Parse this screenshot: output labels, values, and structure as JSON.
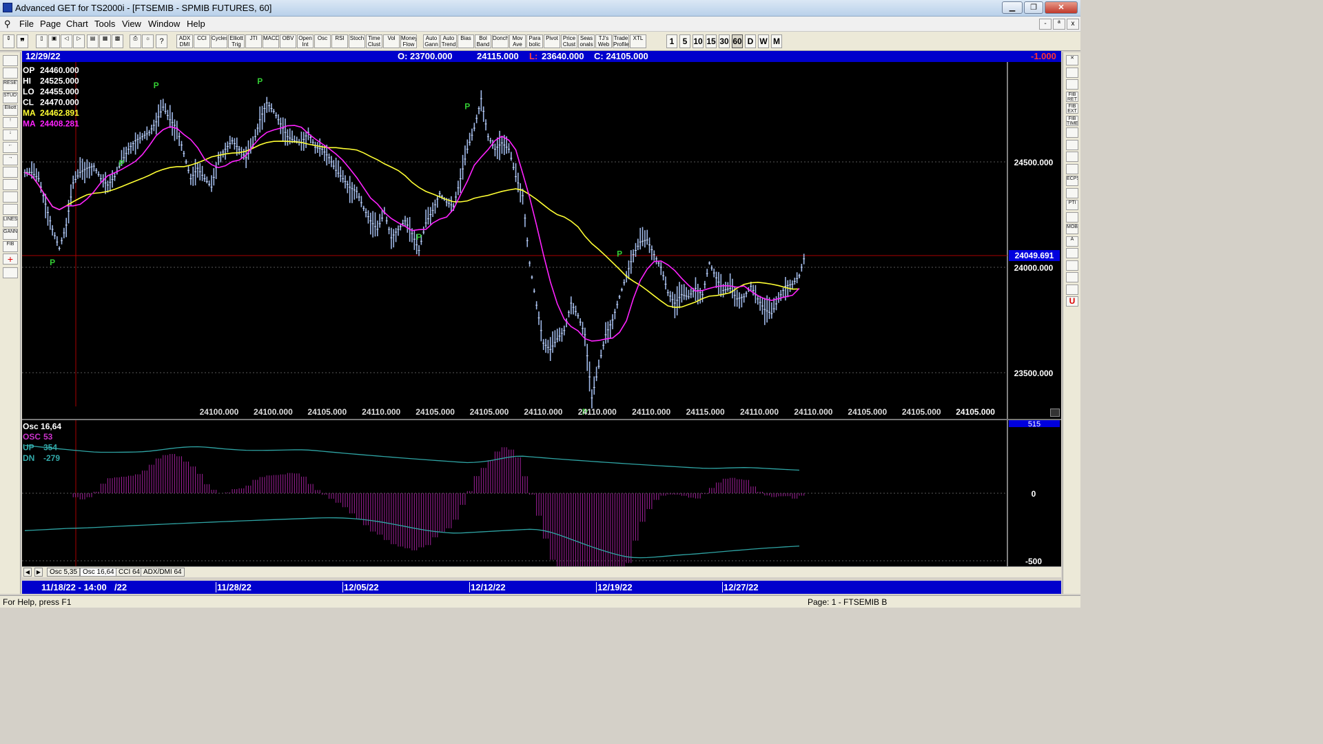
{
  "window": {
    "title": "Advanced GET for TS2000i - [FTSEMIB - SPMIB FUTURES, 60]",
    "minimize": "▁",
    "maximize": "❐",
    "close": "✕",
    "mdi_min": "-",
    "mdi_restore": "ª",
    "mdi_close": "x"
  },
  "menu": [
    "File",
    "Page",
    "Chart",
    "Tools",
    "View",
    "Window",
    "Help"
  ],
  "toolbar": {
    "study_buttons": [
      "ADX DMI",
      "CCI",
      "Cycles",
      "Elliott Trig",
      "JTI",
      "MACD",
      "OBV",
      "Open Int",
      "Osc",
      "RSI",
      "Stoch",
      "Time Clust",
      "Vol",
      "Money Flow",
      "Auto Gann",
      "Auto Trend",
      "Bias",
      "Bol Band",
      "Donch",
      "Mov Ave",
      "Para bolic",
      "Pivot",
      "Price Clust",
      "Seas onals",
      "TJ's Web",
      "Trade Profile",
      "XTL"
    ],
    "intervals": [
      "1",
      "5",
      "10",
      "15",
      "30",
      "60",
      "D",
      "W",
      "M"
    ],
    "selected_interval": "60"
  },
  "left_tools": [
    "",
    "",
    "RESET",
    "STUDY",
    "Elliott",
    "↑",
    "↓",
    "←",
    "→",
    "",
    "",
    "",
    "",
    "LINES",
    "GANN",
    "FIB",
    "+",
    ""
  ],
  "right_tools": [
    "✕",
    "",
    "",
    "FIB RET",
    "FIB EXT",
    "FIB TIME",
    "",
    "",
    "",
    "",
    "ECPS",
    "",
    "PTI",
    "",
    "MOB",
    "A",
    "",
    "",
    "",
    "",
    "U"
  ],
  "infobar": {
    "date": "12/29/22",
    "open": "O: 23700.000",
    "high": "24115.000",
    "low_label": "L:",
    "low": "23640.000",
    "close": "C: 24105.000",
    "change": "-1.000"
  },
  "legend": [
    {
      "label": "OP",
      "value": "24460.000",
      "color": "#ffffff"
    },
    {
      "label": "HI",
      "value": "24525.000",
      "color": "#ffffff"
    },
    {
      "label": "LO",
      "value": "24455.000",
      "color": "#ffffff"
    },
    {
      "label": "CL",
      "value": "24470.000",
      "color": "#ffffff"
    },
    {
      "label": "MA",
      "value": "24462.891",
      "color": "#ffff33"
    },
    {
      "label": "MA",
      "value": "24408.281",
      "color": "#ff22ff"
    }
  ],
  "price_axis": {
    "labels": [
      "24500.000",
      "24000.000",
      "23500.000"
    ],
    "crosshair_value": "24049.691"
  },
  "pivot_label": "P",
  "bottom_values": [
    "24100.000",
    "24100.000",
    "24105.000",
    "24110.000",
    "24105.000",
    "24105.000",
    "24110.000",
    "24110.000",
    "24110.000",
    "24115.000",
    "24110.000",
    "24110.000",
    "24105.000",
    "24105.000",
    "24105.000"
  ],
  "oscillator": {
    "title": "Osc 16,64",
    "lines": [
      {
        "label": "OSC",
        "value": "53",
        "color": "#cc33cc"
      },
      {
        "label": "UP",
        "value": "354",
        "color": "#33aaaa"
      },
      {
        "label": "DN",
        "value": "-279",
        "color": "#33aaaa"
      }
    ],
    "axis_labels": [
      "0",
      "-500"
    ],
    "top_value": "515"
  },
  "tabs": [
    "Osc 5,35",
    "Osc 16,64",
    "CCI 64",
    "ADX/DMI 64"
  ],
  "active_tab": "Osc 16,64",
  "dates": {
    "cursor": "11/18/22 - 14:00",
    "cursor_suffix": "/22",
    "ticks": [
      "11/28/22",
      "12/05/22",
      "12/12/22",
      "12/19/22",
      "12/27/22"
    ]
  },
  "status": {
    "help": "For Help, press F1",
    "page": "Page: 1 - FTSEMIB B"
  },
  "chart_data": {
    "type": "ohlc",
    "symbol": "FTSEMIB - SPMIB FUTURES",
    "interval": "60",
    "ylim": [
      23300,
      24700
    ],
    "close_series": [
      24450,
      24420,
      24300,
      24180,
      24090,
      24200,
      24400,
      24450,
      24470,
      24480,
      24420,
      24390,
      24430,
      24500,
      24560,
      24600,
      24620,
      24640,
      24690,
      24760,
      24700,
      24660,
      24540,
      24420,
      24470,
      24420,
      24380,
      24520,
      24560,
      24600,
      24560,
      24520,
      24580,
      24700,
      24780,
      24740,
      24680,
      24620,
      24600,
      24590,
      24640,
      24570,
      24560,
      24520,
      24460,
      24420,
      24380,
      24360,
      24280,
      24220,
      24180,
      24260,
      24140,
      24180,
      24220,
      24160,
      24080,
      24210,
      24270,
      24350,
      24310,
      24290,
      24420,
      24560,
      24660,
      24800,
      24620,
      24560,
      24590,
      24560,
      24430,
      24340,
      24020,
      23820,
      23640,
      23610,
      23660,
      23700,
      23830,
      23770,
      23680,
      23380,
      23530,
      23680,
      23750,
      23860,
      23960,
      24060,
      24120,
      24130,
      24060,
      24000,
      23880,
      23830,
      23870,
      23860,
      23900,
      23870,
      24020,
      23950,
      23890,
      23900,
      23850,
      23860,
      23910,
      23850,
      23800,
      23780,
      23850,
      23910,
      23920,
      23960,
      24080
    ]
  }
}
